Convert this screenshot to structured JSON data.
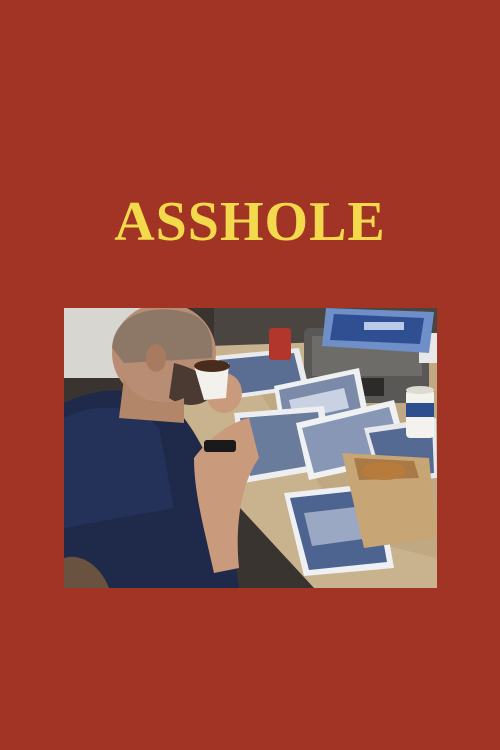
{
  "poster": {
    "title": "ASSHOLE",
    "background_color": "#a23426",
    "title_color": "#f2da4c"
  },
  "still": {
    "subject": "man-drinking-coffee-at-desk-with-photos-and-typewriter"
  }
}
